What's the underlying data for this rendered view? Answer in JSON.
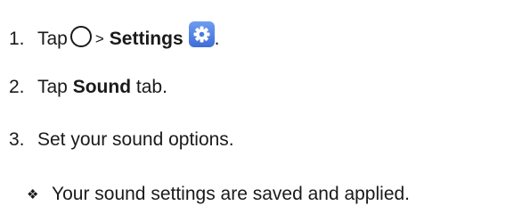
{
  "steps": [
    {
      "number": "1.",
      "before": "Tap",
      "separator": ">",
      "bold": "Settings",
      "after": ".",
      "icons": [
        "home-circle-icon",
        "settings-gear-icon"
      ]
    },
    {
      "number": "2.",
      "before": "Tap",
      "bold": "Sound",
      "after": "tab."
    },
    {
      "number": "3.",
      "text": "Set your sound options."
    }
  ],
  "result": {
    "symbol": "❖",
    "text": "Your sound settings are saved and applied."
  },
  "colors": {
    "text": "#1a1a1a",
    "settings_icon": "#4a7be0"
  }
}
